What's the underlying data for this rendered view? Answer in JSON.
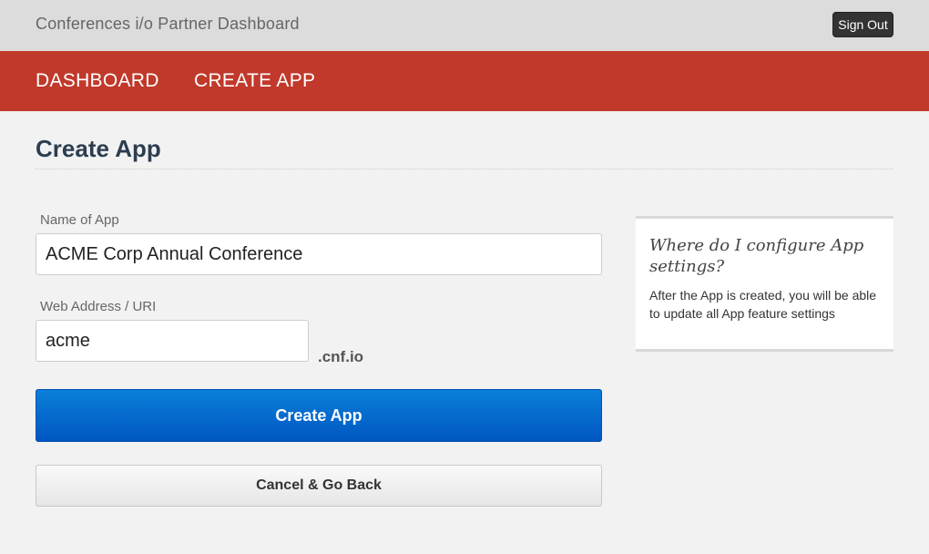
{
  "header": {
    "app_title": "Conferences i/o Partner Dashboard",
    "signout_label": "Sign Out"
  },
  "nav": {
    "items": [
      {
        "label": "DASHBOARD"
      },
      {
        "label": "CREATE APP"
      }
    ]
  },
  "page": {
    "title": "Create App"
  },
  "form": {
    "name_label": "Name of App",
    "name_value": "ACME Corp Annual Conference",
    "uri_label": "Web Address / URI",
    "uri_value": "acme",
    "uri_suffix": ".cnf.io",
    "submit_label": "Create App",
    "cancel_label": "Cancel & Go Back"
  },
  "help": {
    "title": "Where do I configure App settings?",
    "body": "After the App is created, you will be able to update all App feature settings"
  },
  "colors": {
    "nav_bg": "#c0392b",
    "primary_button": "#0057c2",
    "title_color": "#2c3e50"
  }
}
